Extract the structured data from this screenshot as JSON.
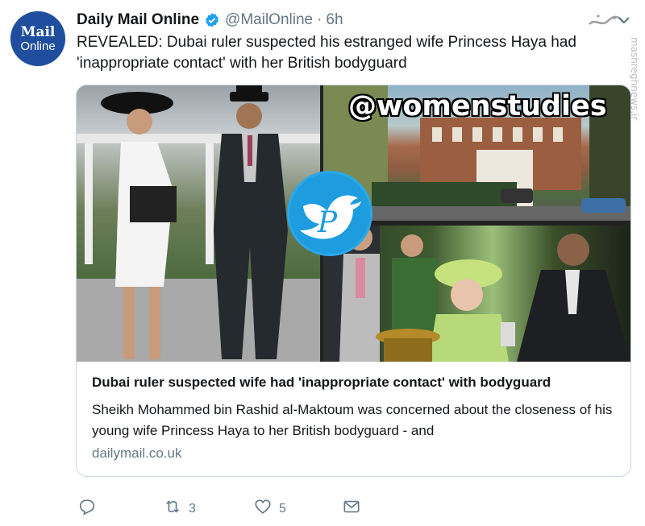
{
  "tweet": {
    "author_name": "Daily Mail Online",
    "handle": "@MailOnline",
    "separator": "·",
    "time": "6h",
    "avatar_line1": "Mail",
    "avatar_line2": "Online",
    "text": "REVEALED: Dubai ruler suspected his estranged wife Princess Haya had 'inappropriate contact' with her British bodyguard"
  },
  "card": {
    "title": "Dubai ruler suspected wife had 'inappropriate contact' with bodyguard",
    "description": "Sheikh Mohammed bin Rashid al-Maktoum was concerned about the closeness of his young wife Princess Haya to her British bodyguard - and",
    "domain": "dailymail.co.uk"
  },
  "actions": {
    "reply_icon": "reply-icon",
    "retweet_icon": "retweet-icon",
    "retweet_count": "3",
    "like_icon": "heart-icon",
    "like_count": "5",
    "dm_icon": "envelope-icon"
  },
  "overlay": {
    "watermark": "@womenstudies",
    "side_text": "mashreghnews.ir",
    "logo_letter": "P"
  },
  "colors": {
    "verified": "#1da1f2",
    "secondary_text": "#657786",
    "avatar_bg": "#1f4e9e",
    "card_border": "#ccd6dd"
  }
}
